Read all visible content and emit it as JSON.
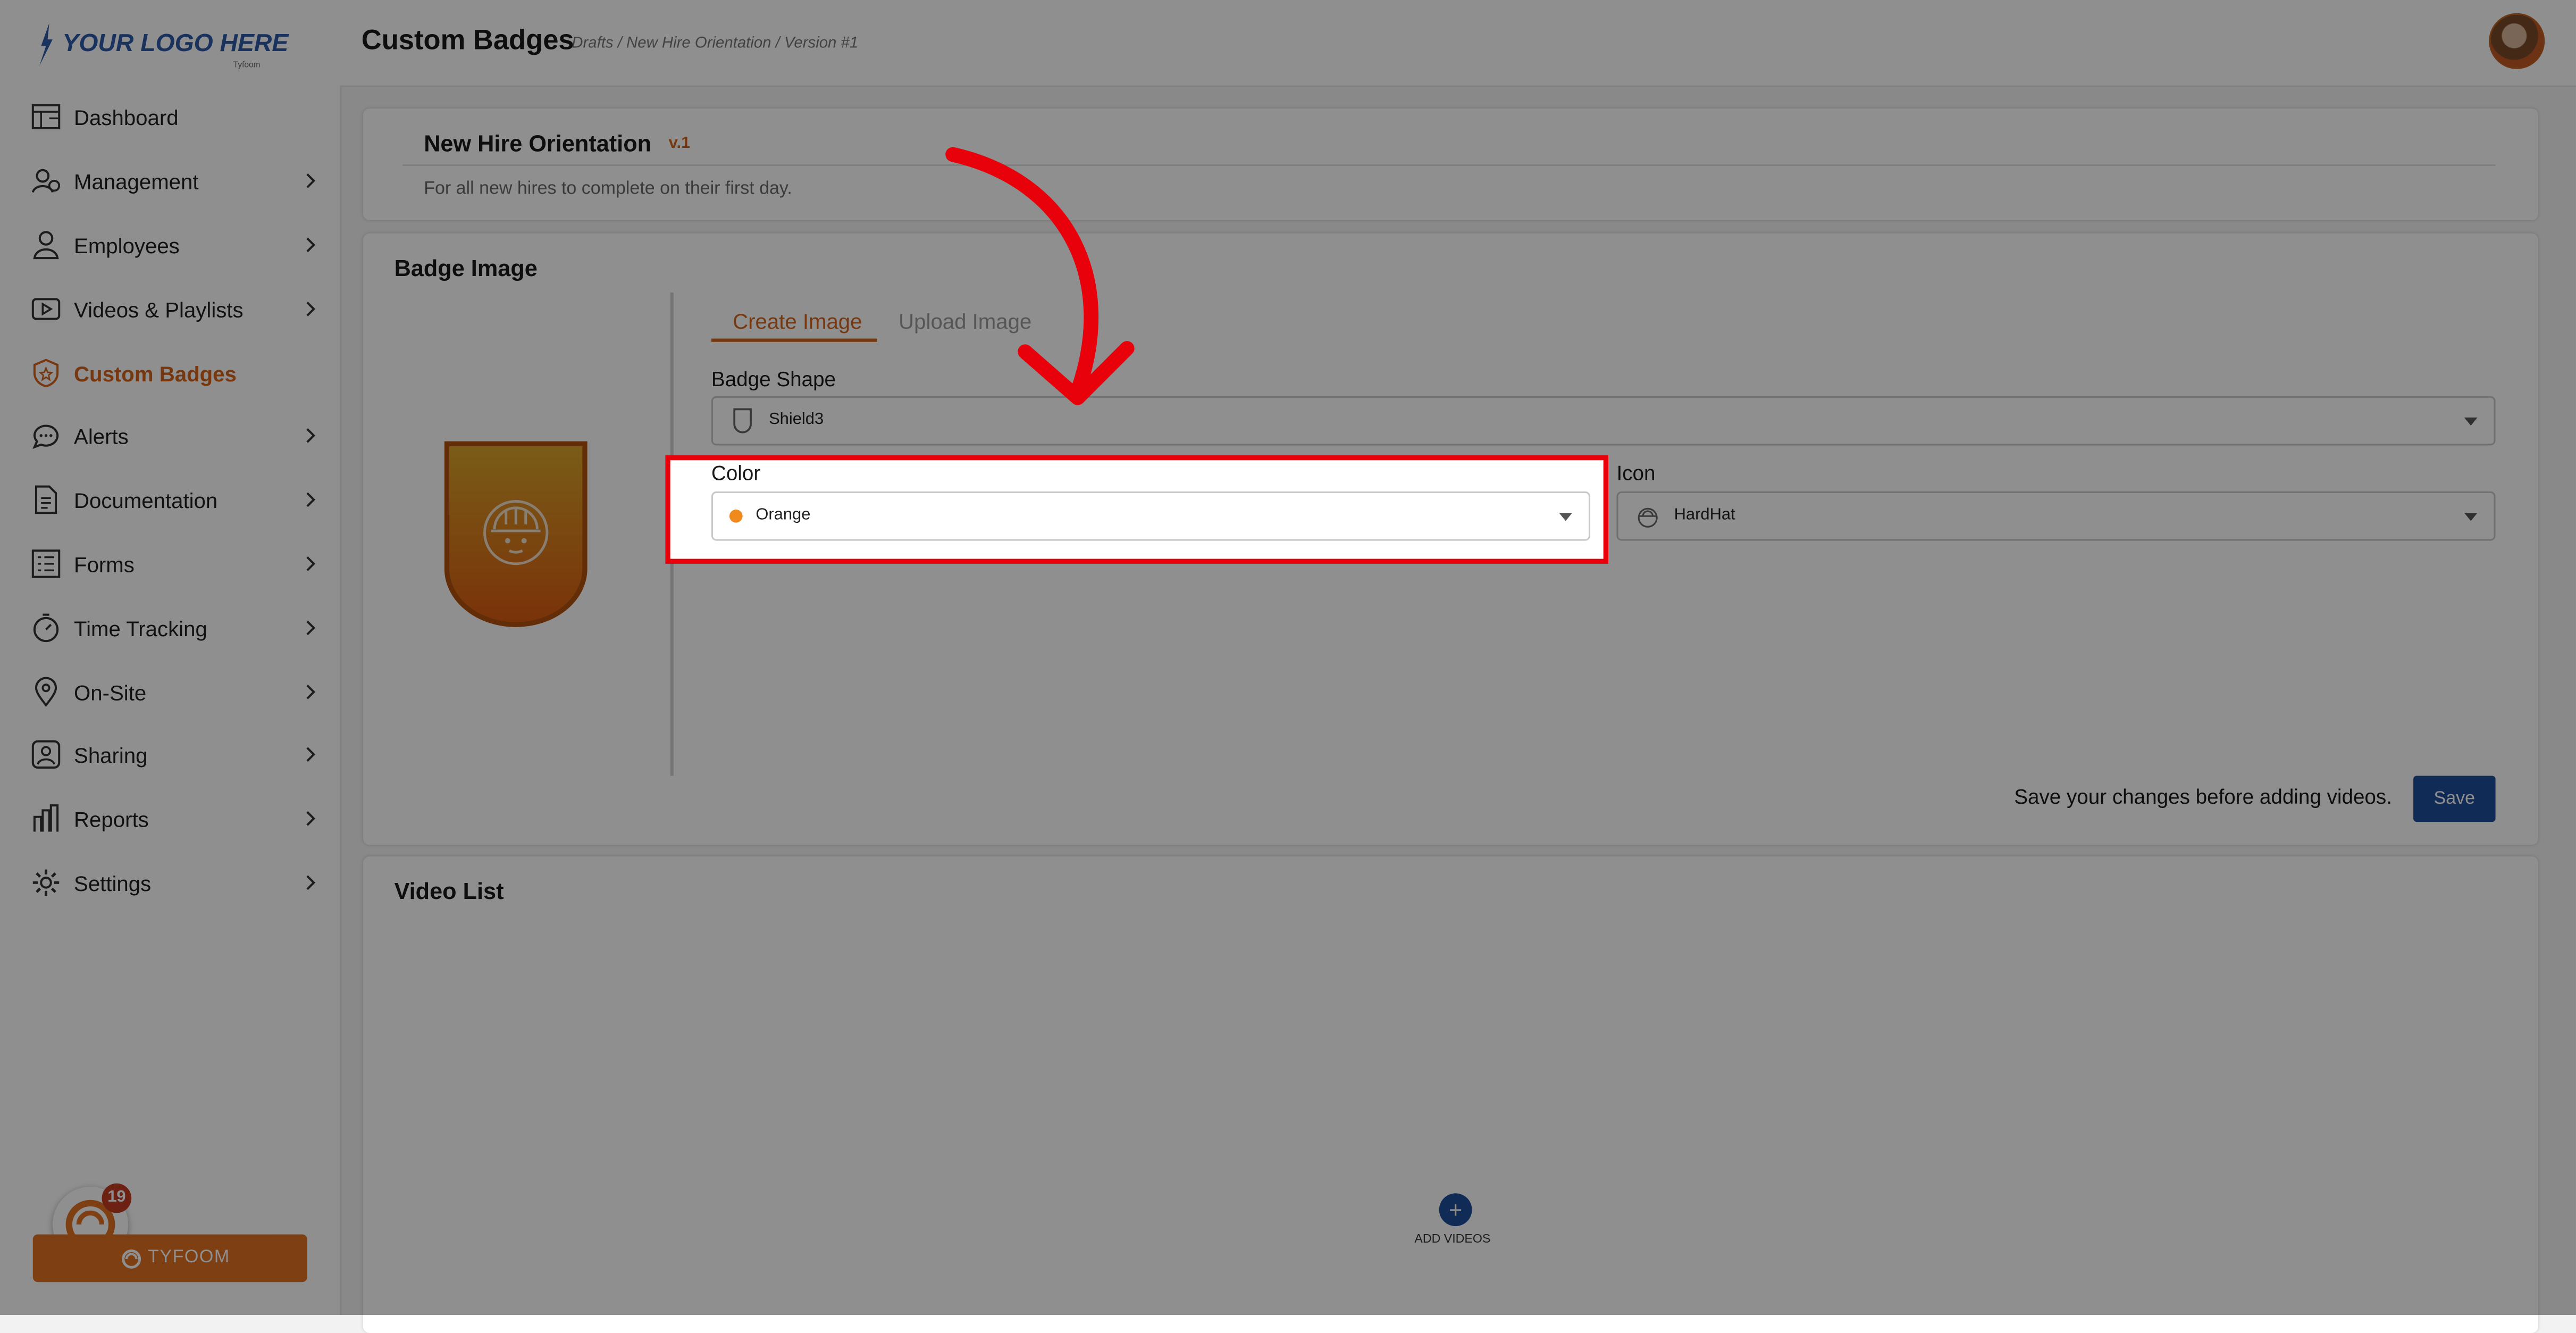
{
  "logo": {
    "text": "YOUR LOGO HERE",
    "sub": "Tyfoom"
  },
  "sidebar": {
    "items": [
      {
        "label": "Dashboard",
        "icon": "dashboard-icon",
        "chevron": false
      },
      {
        "label": "Management",
        "icon": "management-icon",
        "chevron": true
      },
      {
        "label": "Employees",
        "icon": "person-icon",
        "chevron": true
      },
      {
        "label": "Videos & Playlists",
        "icon": "video-icon",
        "chevron": true
      },
      {
        "label": "Custom Badges",
        "icon": "badge-icon",
        "chevron": false,
        "active": true
      },
      {
        "label": "Alerts",
        "icon": "chat-icon",
        "chevron": true
      },
      {
        "label": "Documentation",
        "icon": "document-icon",
        "chevron": true
      },
      {
        "label": "Forms",
        "icon": "list-icon",
        "chevron": true
      },
      {
        "label": "Time Tracking",
        "icon": "stopwatch-icon",
        "chevron": true
      },
      {
        "label": "On-Site",
        "icon": "location-pin-icon",
        "chevron": true
      },
      {
        "label": "Sharing",
        "icon": "share-icon",
        "chevron": true
      },
      {
        "label": "Reports",
        "icon": "bar-chart-icon",
        "chevron": true
      },
      {
        "label": "Settings",
        "icon": "gear-icon",
        "chevron": true
      }
    ],
    "tyfoom_button": "TYFOOM",
    "notification_count": "19"
  },
  "header": {
    "title": "Custom Badges",
    "breadcrumb": "Drafts  /  New Hire Orientation  /  Version #1"
  },
  "course": {
    "title": "New Hire Orientation",
    "version": "v.1",
    "description": "For all new hires to complete on their first day."
  },
  "badge_section": {
    "title": "Badge Image",
    "tabs": {
      "create": "Create Image",
      "upload": "Upload Image"
    },
    "shape_label": "Badge Shape",
    "shape_value": "Shield3",
    "color_label": "Color",
    "color_value": "Orange",
    "icon_label": "Icon",
    "icon_value": "HardHat",
    "save_note": "Save your changes before adding videos.",
    "save_label": "Save"
  },
  "video_section": {
    "title": "Video List",
    "add_label": "ADD VIDEOS"
  },
  "colors": {
    "accent_orange": "#d4631b",
    "primary_blue": "#1f4e9c",
    "highlight_red": "#e8000a",
    "badge_gradient_top": "#d9a52a",
    "badge_gradient_bottom": "#d95a10"
  }
}
